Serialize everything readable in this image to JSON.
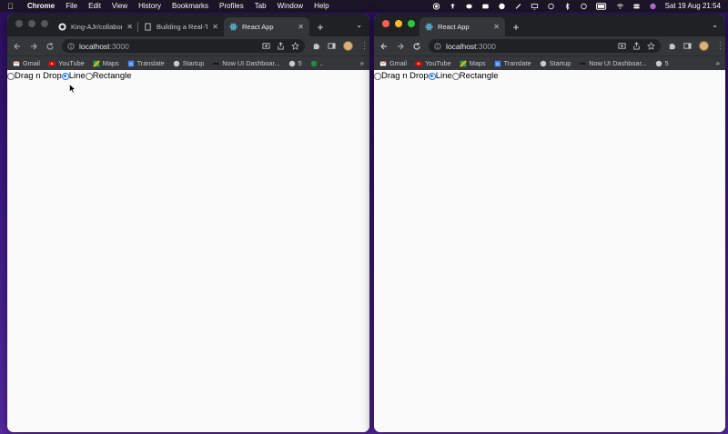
{
  "menubar": {
    "app_name": "Chrome",
    "menus": [
      "File",
      "Edit",
      "View",
      "History",
      "Bookmarks",
      "Profiles",
      "Tab",
      "Window",
      "Help"
    ],
    "clock": "Sat 19 Aug  21:54"
  },
  "left_window": {
    "tabs": [
      {
        "title": "King-AJr/collabor",
        "icon": "github-icon"
      },
      {
        "title": "Building a Real-Ti",
        "icon": "document-icon"
      },
      {
        "title": "React App",
        "icon": "react-icon",
        "active": true
      }
    ],
    "url_host": "localhost",
    "url_port": ":3000",
    "bookmarks": [
      {
        "label": "Gmail",
        "icon": "gmail-icon"
      },
      {
        "label": "YouTube",
        "icon": "youtube-icon"
      },
      {
        "label": "Maps",
        "icon": "maps-icon"
      },
      {
        "label": "Translate",
        "icon": "translate-icon"
      },
      {
        "label": "Startup",
        "icon": "globe-icon"
      },
      {
        "label": "Now UI Dashboar...",
        "icon": "dashboard-icon"
      },
      {
        "label": "5",
        "icon": "globe-icon"
      },
      {
        "label": "..",
        "icon": "extension-icon"
      }
    ],
    "bookmarks_more": "»",
    "radio_options": [
      "Drag n Drop",
      "Line",
      "Rectangle"
    ],
    "selected_option": "Line"
  },
  "right_window": {
    "tabs": [
      {
        "title": "React App",
        "icon": "react-icon",
        "active": true
      }
    ],
    "url_host": "localhost",
    "url_port": ":3000",
    "bookmarks": [
      {
        "label": "Gmail",
        "icon": "gmail-icon"
      },
      {
        "label": "YouTube",
        "icon": "youtube-icon"
      },
      {
        "label": "Maps",
        "icon": "maps-icon"
      },
      {
        "label": "Translate",
        "icon": "translate-icon"
      },
      {
        "label": "Startup",
        "icon": "globe-icon"
      },
      {
        "label": "Now UI Dashboar...",
        "icon": "dashboard-icon"
      },
      {
        "label": "5",
        "icon": "globe-icon"
      }
    ],
    "bookmarks_more": "»",
    "radio_options": [
      "Drag n Drop",
      "Line",
      "Rectangle"
    ],
    "selected_option": "Line"
  },
  "colors": {
    "desktop": "#3b1a85",
    "chrome_dark": "#202124",
    "toolbar": "#35363a",
    "radio_accent": "#1a73e8"
  }
}
